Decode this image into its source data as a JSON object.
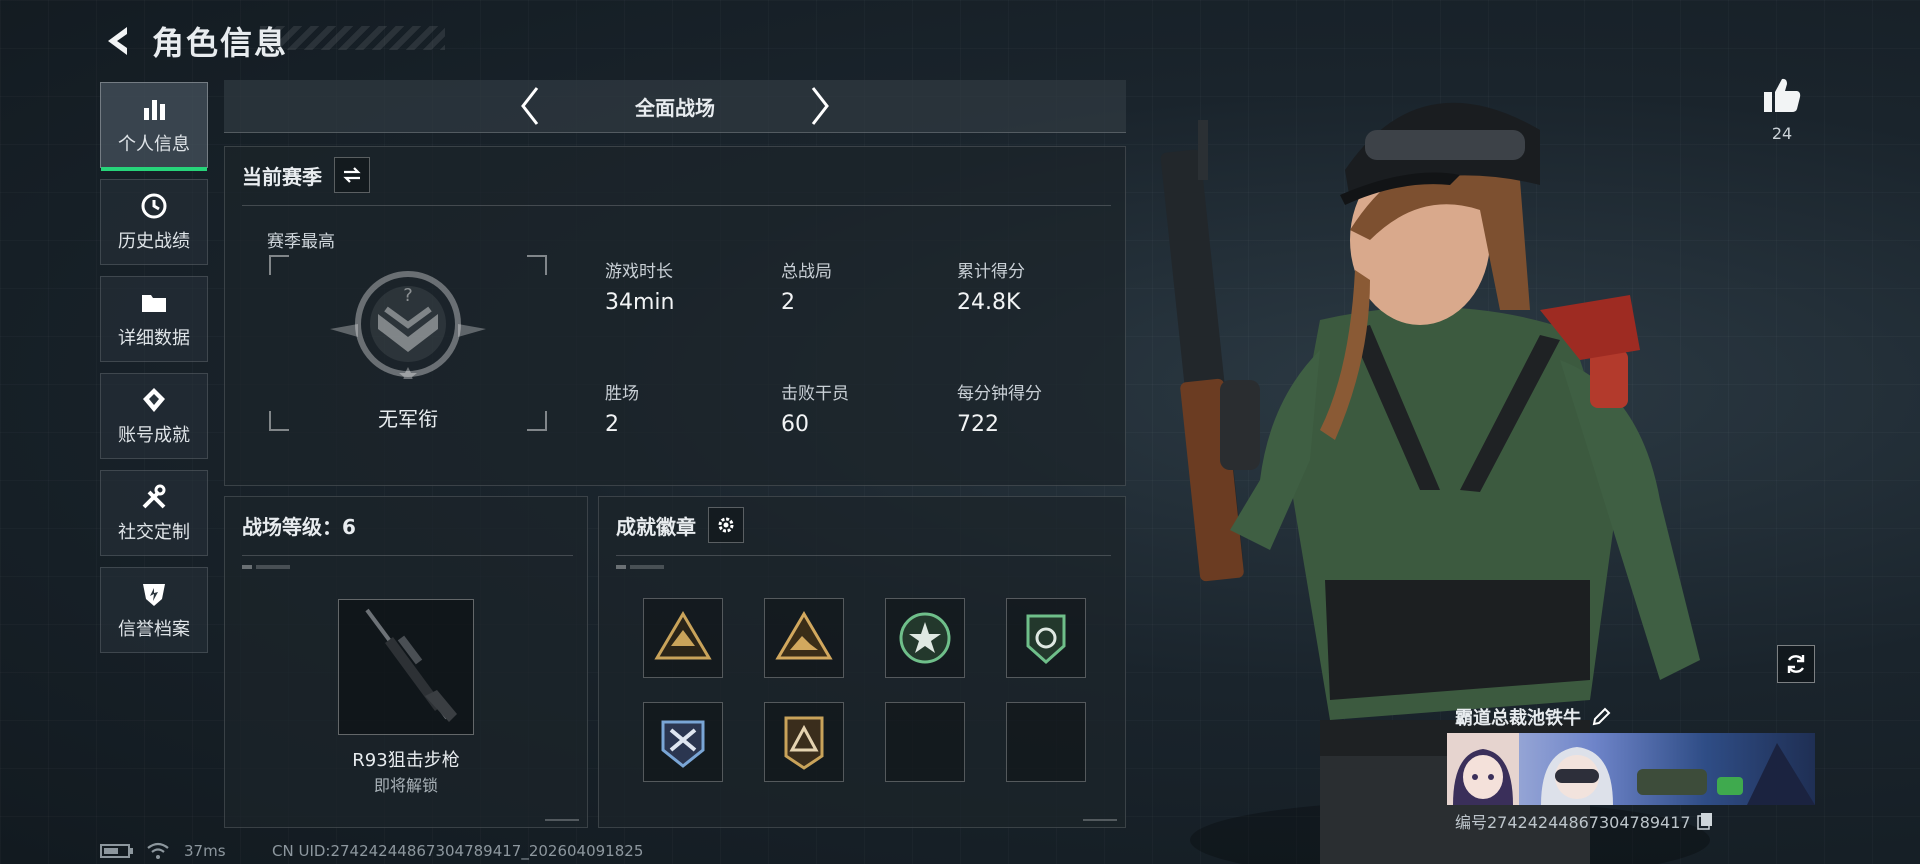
{
  "header": {
    "title": "角色信息"
  },
  "sidebar": {
    "items": [
      {
        "label": "个人信息",
        "icon": "bar-chart-icon",
        "active": true
      },
      {
        "label": "历史战绩",
        "icon": "history-clock-icon"
      },
      {
        "label": "详细数据",
        "icon": "folder-icon"
      },
      {
        "label": "账号成就",
        "icon": "achievement-icon"
      },
      {
        "label": "社交定制",
        "icon": "tools-icon"
      },
      {
        "label": "信誉档案",
        "icon": "shield-icon"
      }
    ]
  },
  "mode": {
    "title": "全面战场"
  },
  "season": {
    "title": "当前赛季",
    "best_label": "赛季最高",
    "rank_name": "无军衔",
    "stats": [
      {
        "label": "游戏时长",
        "value": "34min"
      },
      {
        "label": "总战局",
        "value": "2"
      },
      {
        "label": "累计得分",
        "value": "24.8K"
      },
      {
        "label": "胜场",
        "value": "2"
      },
      {
        "label": "击败干员",
        "value": "60"
      },
      {
        "label": "每分钟得分",
        "value": "722"
      }
    ]
  },
  "battlefield": {
    "title": "战场等级：6",
    "weapon_name": "R93狙击步枪",
    "weapon_status": "即将解锁"
  },
  "badges": {
    "title": "成就徽章",
    "items": [
      {
        "icon": "triangle-emblem-icon",
        "color": "#c9a35a"
      },
      {
        "icon": "triangle-emblem-icon",
        "color": "#c9a35a"
      },
      {
        "icon": "star-emblem-icon",
        "color": "#6fbf8a"
      },
      {
        "icon": "shield-emblem-icon",
        "color": "#6fbf8a"
      },
      {
        "icon": "shield-emblem-icon",
        "color": "#7aa6d6"
      },
      {
        "icon": "triangle-emblem-icon",
        "color": "#c9a35a"
      },
      {
        "icon": "empty-slot"
      },
      {
        "icon": "empty-slot"
      }
    ]
  },
  "profile": {
    "like_count": "24",
    "player_name": "霸道总裁池铁牛",
    "player_id": "编号274242448673047894​17"
  },
  "status_bar": {
    "ping": "37ms",
    "uid": "CN UID:274242448673047894​17_202604091825"
  },
  "colors": {
    "accent": "#27d47a",
    "panel": "#1c242a"
  }
}
